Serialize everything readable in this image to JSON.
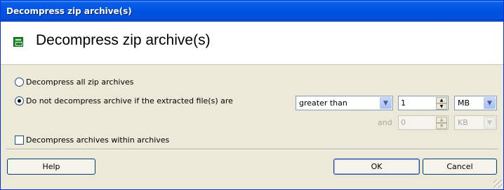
{
  "window": {
    "title": "Decompress zip archive(s)"
  },
  "header": {
    "title": "Decompress zip archive(s)",
    "icon": "zip-archive-icon"
  },
  "options": {
    "decompress_all": {
      "label": "Decompress all zip archives",
      "checked": false
    },
    "do_not_decompress": {
      "label": "Do not decompress archive if the extracted file(s) are",
      "checked": true
    },
    "nested": {
      "label": "Decompress archives within archives",
      "checked": false
    }
  },
  "size_filter": {
    "comparison": "greater than",
    "value": "1",
    "unit": "MB",
    "and_label": "and",
    "second_value": "0",
    "second_unit": "KB"
  },
  "buttons": {
    "help": "Help",
    "ok": "OK",
    "cancel": "Cancel"
  }
}
